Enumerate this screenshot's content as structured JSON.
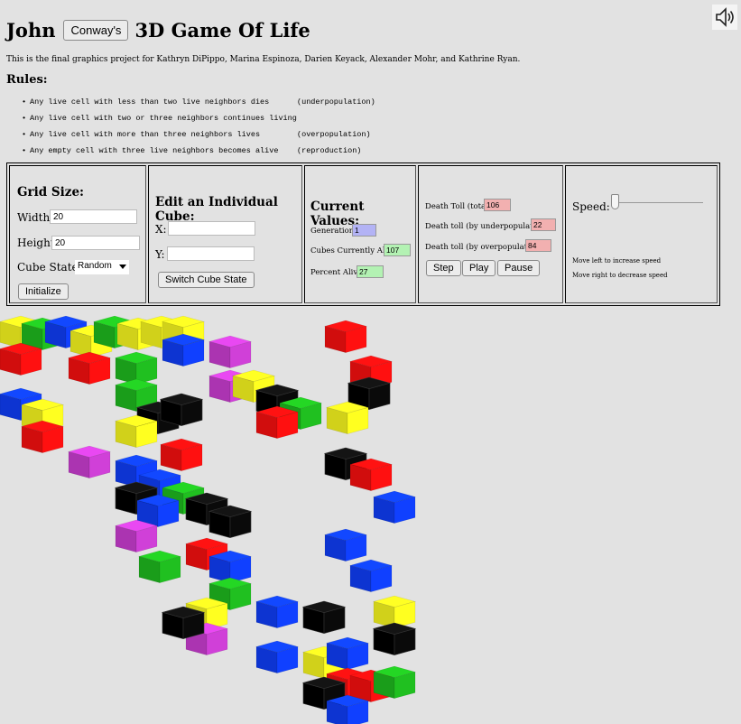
{
  "header": {
    "title_before": "John",
    "title_button": "Conway's",
    "title_after": "3D Game Of Life",
    "sound_icon": "speaker-icon"
  },
  "intro": "This is the final graphics project for Kathryn DiPippo, Marina Espinoza, Darien Keyack, Alexander Mohr, and Kathrine Ryan.",
  "rules": {
    "heading": "Rules:",
    "items": [
      {
        "text": "Any live cell with less than two live neighbors dies",
        "note": "(underpopulation)"
      },
      {
        "text": "Any live cell with two or three neighbors continues living",
        "note": ""
      },
      {
        "text": "Any live cell with more than three neighbors lives",
        "note": "(overpopulation)"
      },
      {
        "text": "Any empty cell with three live neighbors becomes alive",
        "note": "(reproduction)"
      }
    ]
  },
  "grid_panel": {
    "heading": "Grid Size:",
    "width_label": "Width:",
    "width_value": "20",
    "height_label": "Height:",
    "height_value": "20",
    "states_label": "Cube States:",
    "states_value": "Random",
    "init_button": "Initialize"
  },
  "edit_panel": {
    "heading": "Edit an Individual Cube:",
    "x_label": "X:",
    "x_value": "",
    "y_label": "Y:",
    "y_value": "",
    "switch_button": "Switch Cube State"
  },
  "values_panel": {
    "heading": "Current Values:",
    "generation_label": "Generation:",
    "generation_value": "1",
    "alive_label": "Cubes Currently Alive:",
    "alive_value": "107",
    "percent_label": "Percent Alive:",
    "percent_value": "27"
  },
  "deaths_panel": {
    "total_label": "Death Toll (total):",
    "total_value": "106",
    "under_label": "Death toll (by underpopulation):",
    "under_value": "22",
    "over_label": "Death toll (by overpopulation):",
    "over_value": "84",
    "step_button": "Step",
    "play_button": "Play",
    "pause_button": "Pause"
  },
  "speed_panel": {
    "label": "Speed:",
    "speed_level": 0,
    "hint_left": "Move left to increase speed",
    "hint_right": "Move right to decrease speed"
  },
  "colors": {
    "background": "#e2e2e2",
    "generation_box": "#b3b3f5",
    "alive_box": "#b3f2b3",
    "death_box": "#f2b0b0",
    "cube_red": "#ff1010",
    "cube_yellow": "#ffff20",
    "cube_green": "#20c020",
    "cube_blue": "#1040ff",
    "cube_black": "#000000",
    "cube_magenta": "#d040d8"
  }
}
